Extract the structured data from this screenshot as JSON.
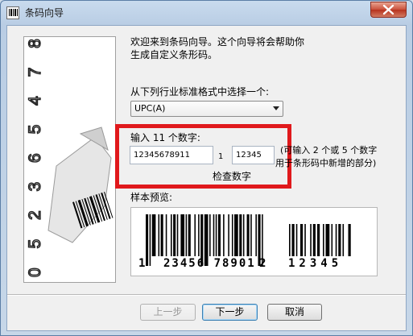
{
  "window": {
    "title": "条码向导"
  },
  "intro": {
    "line1": "欢迎来到条码向导。这个向导将会帮助你",
    "line2": "生成自定义条形码。"
  },
  "format": {
    "label": "从下列行业标准格式中选择一个:",
    "selected": "UPC(A)"
  },
  "digits": {
    "label": "输入 11 个数字:",
    "main_value": "12345678911",
    "separator": "1",
    "addon_value": "12345",
    "hint_line1": "(可输入 2 个或 5 个数字",
    "hint_line2": "用于条形码中新增的部分)",
    "check_label": "检查数字"
  },
  "preview": {
    "label": "样本预览:",
    "human_readable": {
      "left": "1",
      "main": "23456 78901",
      "check": "2",
      "addon": "12345"
    }
  },
  "side_image": {
    "digits": "0 5 2 3 6 5 4 7 8 9 6 9 0"
  },
  "buttons": {
    "back": "上一步",
    "next": "下一步",
    "cancel": "取消"
  },
  "colors": {
    "highlight": "#e0191c",
    "accent": "#3c7fb1"
  }
}
